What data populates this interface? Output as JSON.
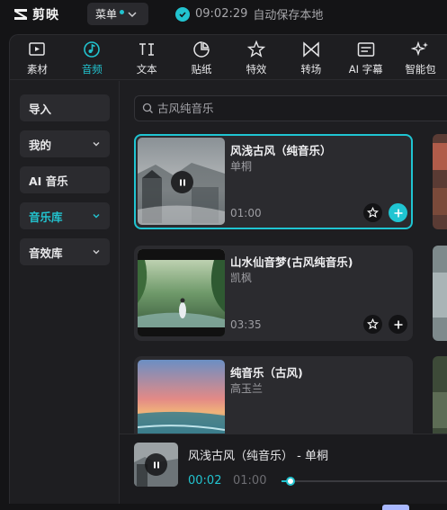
{
  "app": {
    "name": "剪映"
  },
  "topbar": {
    "menu_label": "菜单",
    "autosave_time": "09:02:29",
    "autosave_text": "自动保存本地"
  },
  "tools": [
    {
      "label": "素材",
      "icon": "media-play-icon",
      "active": false
    },
    {
      "label": "音频",
      "icon": "music-note-icon",
      "active": true
    },
    {
      "label": "文本",
      "icon": "text-icon",
      "active": false
    },
    {
      "label": "贴纸",
      "icon": "sticker-icon",
      "active": false
    },
    {
      "label": "特效",
      "icon": "effects-star-icon",
      "active": false
    },
    {
      "label": "转场",
      "icon": "transition-icon",
      "active": false
    },
    {
      "label": "AI 字幕",
      "icon": "caption-icon",
      "active": false
    },
    {
      "label": "智能包",
      "icon": "smart-sparkle-icon",
      "active": false
    }
  ],
  "sidebar": {
    "items": [
      {
        "label": "导入",
        "has_chevron": false,
        "active": false
      },
      {
        "label": "我的",
        "has_chevron": true,
        "active": false
      },
      {
        "label": "AI 音乐",
        "has_chevron": false,
        "active": false
      },
      {
        "label": "音乐库",
        "has_chevron": true,
        "active": true
      },
      {
        "label": "音效库",
        "has_chevron": true,
        "active": false
      }
    ]
  },
  "search": {
    "placeholder": "古风纯音乐"
  },
  "songs": [
    {
      "title": "风浅古风（纯音乐）",
      "artist": "单桐",
      "duration": "01:00",
      "selected": true
    },
    {
      "title": "山水仙音梦(古风纯音乐)",
      "artist": "凯枫",
      "duration": "03:35",
      "selected": false
    },
    {
      "title": "纯音乐（古风)",
      "artist": "高玉兰",
      "duration": "",
      "selected": false
    }
  ],
  "player": {
    "title": "风浅古风（纯音乐） - 单桐",
    "current_time": "00:02",
    "total_time": "01:00",
    "progress": 0.033
  },
  "colors": {
    "accent": "#22c3cf",
    "background": "#1e1e21",
    "card": "#2b2b2f"
  }
}
